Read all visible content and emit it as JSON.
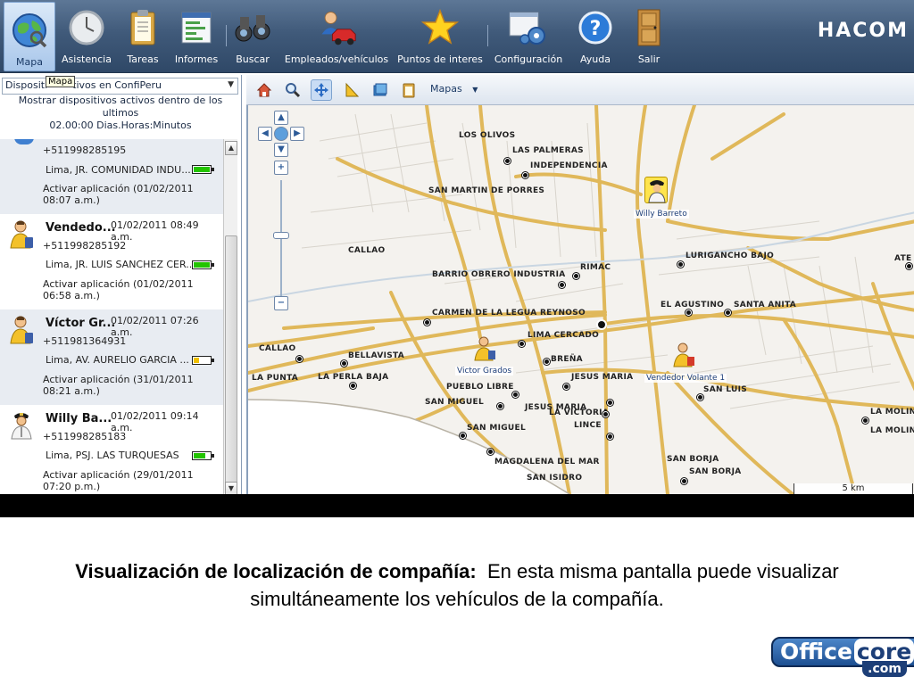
{
  "toolbar": {
    "items": [
      {
        "label": "Mapa",
        "icon": "globe-icon"
      },
      {
        "label": "Asistencia",
        "icon": "clock-icon"
      },
      {
        "label": "Tareas",
        "icon": "clipboard-icon"
      },
      {
        "label": "Informes",
        "icon": "report-icon"
      },
      {
        "label": "Buscar",
        "icon": "binoculars-icon"
      },
      {
        "label": "Empleados/vehículos",
        "icon": "employee-vehicle-icon"
      },
      {
        "label": "Puntos de interes",
        "icon": "star-icon"
      },
      {
        "label": "Configuración",
        "icon": "settings-icon"
      },
      {
        "label": "Ayuda",
        "icon": "help-icon"
      },
      {
        "label": "Salir",
        "icon": "door-icon"
      }
    ],
    "active": "Mapa",
    "brand": "HACOM"
  },
  "left_panel": {
    "device_select": "Dispositivos activos en ConfiPeru",
    "device_select_visible_prefix": "Dispositi",
    "device_select_visible_suffix": "tivos en ConfiPeru",
    "tooltip": "Mapa",
    "filter_line1": "Mostrar dispositivos activos dentro de los ultimos",
    "filter_line2": "02.00:00 Dias.Horas:Minutos",
    "devices": [
      {
        "name": "",
        "time": "",
        "phone": "+511998285195",
        "address": "Lima, JR. COMUNIDAD INDU...",
        "battery": 1.0,
        "activation": "Activar aplicación (01/02/2011 08:07 a.m.)",
        "avatar": "vendor-icon"
      },
      {
        "name": "Vendedo...",
        "time": "01/02/2011 08:49 a.m.",
        "phone": "+511998285192",
        "address": "Lima, JR. LUIS SANCHEZ CER...",
        "battery": 1.0,
        "activation": "Activar aplicación (01/02/2011 06:58 a.m.)",
        "avatar": "vendor-icon"
      },
      {
        "name": "Víctor Gr...",
        "time": "01/02/2011 07:26 a.m.",
        "phone": "+511981364931",
        "address": "Lima, AV. AURELIO GARCIA ...",
        "battery": 0.35,
        "activation": "Activar aplicación (31/01/2011 08:21 a.m.)",
        "avatar": "vendor-icon"
      },
      {
        "name": "Willy Ba...",
        "time": "01/02/2011 09:14 a.m.",
        "phone": "+511998285183",
        "address": "Lima, PSJ. LAS TURQUESAS",
        "battery": 0.7,
        "activation": "Activar aplicación (29/01/2011 07:20 p.m.)",
        "avatar": "police-icon"
      }
    ]
  },
  "map_toolbar": {
    "tools": [
      "home-icon",
      "zoom-icon",
      "pan-icon",
      "measure-icon",
      "layers-icon",
      "clipboard-icon"
    ],
    "selected_tool": "pan-icon",
    "maps_menu": "Mapas"
  },
  "map": {
    "places": [
      "LOS OLIVOS",
      "LAS PALMERAS",
      "INDEPENDENCIA",
      "SAN MARTIN DE PORRES",
      "CALLAO",
      "BARRIO OBRERO INDUSTRIA",
      "RIMAC",
      "LURIGANCHO BAJO",
      "ATE",
      "EL AGUSTINO",
      "SANTA ANITA",
      "CARMEN DE LA LEGUA REYNOSO",
      "LIMA CERCADO",
      "CALLAO",
      "BELLAVISTA",
      "BREÑA",
      "LA PUNTA",
      "LA PERLA BAJA",
      "JESUS MARIA",
      "SAN LUIS",
      "PUEBLO LIBRE",
      "SAN MIGUEL",
      "JESUS MARIA",
      "LA VICTORIA",
      "LINCE",
      "LA MOLINA",
      "SAN MIGUEL",
      "LA MOLINA",
      "MAGDALENA DEL MAR",
      "SAN BORJA",
      "SAN BORJA",
      "SAN ISIDRO"
    ],
    "markers": [
      {
        "label": "Willy Barreto",
        "type": "police-icon"
      },
      {
        "label": "Victor Grados",
        "type": "vendor-icon"
      },
      {
        "label": "Vendedor Volante 1",
        "type": "vendor-icon"
      }
    ],
    "scale": "5 km"
  },
  "caption": {
    "bold": "Visualización de localización de compañía:",
    "text": "En esta misma pantalla puede visualizar simultáneamente los vehículos de la compañía."
  },
  "logo": {
    "office": "Office",
    "core": "core",
    "domain": ".com"
  }
}
